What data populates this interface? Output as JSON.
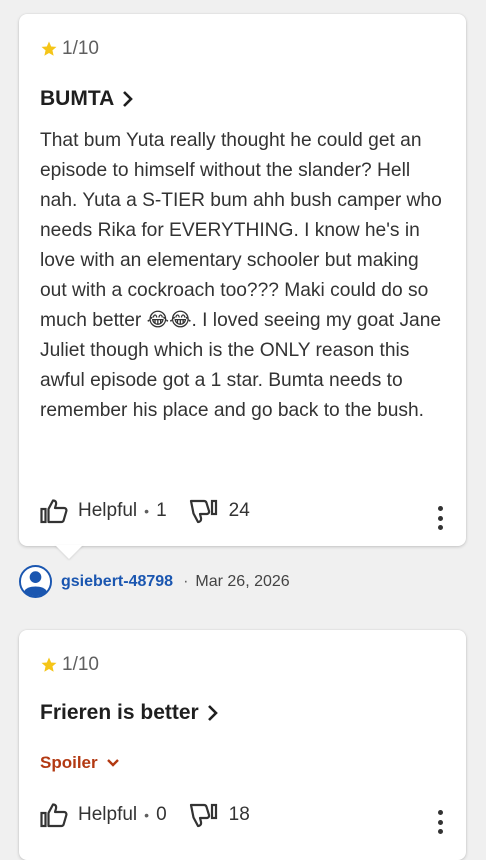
{
  "reviews": [
    {
      "rating": "1/10",
      "title": "BUMTA",
      "body": "That bum Yuta really thought he could get an episode to himself without the slander? Hell nah. Yuta a S-TIER bum ahh bush camper who needs Rika for EVERYTHING. I know he's in love with an elementary schooler but making out with a cockroach too??? Maki could do so much better 😂😂. I loved seeing my goat Jane Juliet though which is the ONLY reason this awful episode got a 1 star. Bumta needs to remember his place and go back to the bush.",
      "helpful_label": "Helpful",
      "helpful_count": "1",
      "not_helpful_count": "24",
      "author": "gsiebert-48798",
      "date": "Mar 26, 2026"
    },
    {
      "rating": "1/10",
      "title": "Frieren is better",
      "spoiler_label": "Spoiler",
      "helpful_label": "Helpful",
      "helpful_count": "0",
      "not_helpful_count": "18"
    }
  ],
  "colors": {
    "star": "#f5c518",
    "link": "#1a56b0",
    "spoiler": "#b33912",
    "background": "#f0f0f0"
  },
  "icons": [
    "star-icon",
    "chevron-right-icon",
    "thumbs-up-icon",
    "thumbs-down-icon",
    "more-options-icon",
    "avatar-icon",
    "chevron-down-icon"
  ]
}
